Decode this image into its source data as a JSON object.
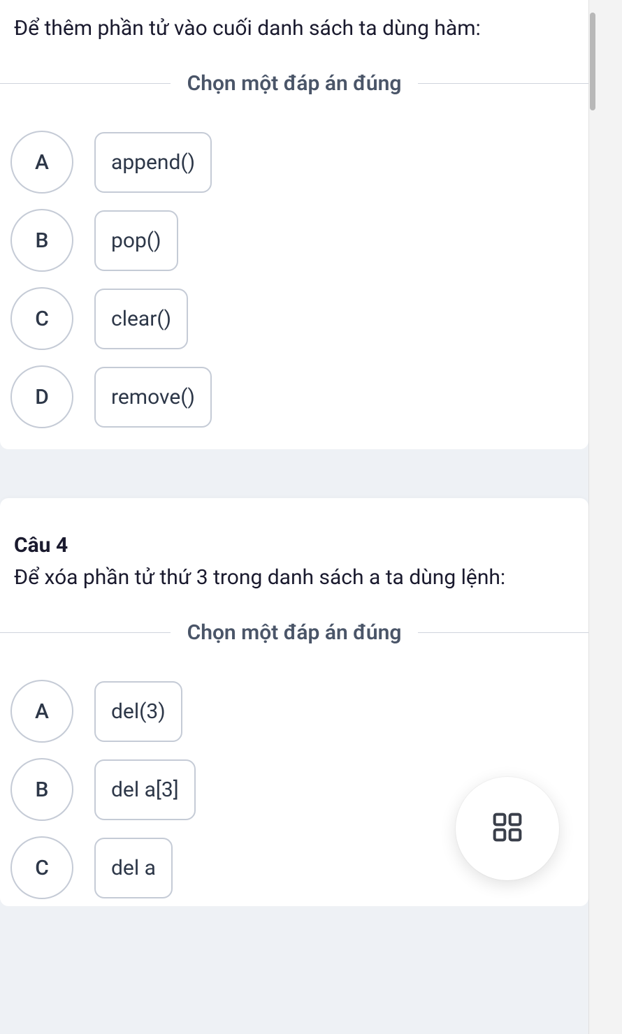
{
  "q1": {
    "text": "Để thêm phần tử vào cuối danh sách ta dùng hàm:",
    "instruction": "Chọn một đáp án đúng",
    "options": [
      {
        "letter": "A",
        "label": "append()"
      },
      {
        "letter": "B",
        "label": "pop()"
      },
      {
        "letter": "C",
        "label": "clear()"
      },
      {
        "letter": "D",
        "label": "remove()"
      }
    ]
  },
  "q2": {
    "number": "Câu 4",
    "text": "Để xóa phần tử thứ 3 trong danh sách a ta dùng lệnh:",
    "instruction": "Chọn một đáp án đúng",
    "options": [
      {
        "letter": "A",
        "label": "del(3)"
      },
      {
        "letter": "B",
        "label": "del a[3]"
      },
      {
        "letter": "C",
        "label": "del a"
      }
    ]
  }
}
